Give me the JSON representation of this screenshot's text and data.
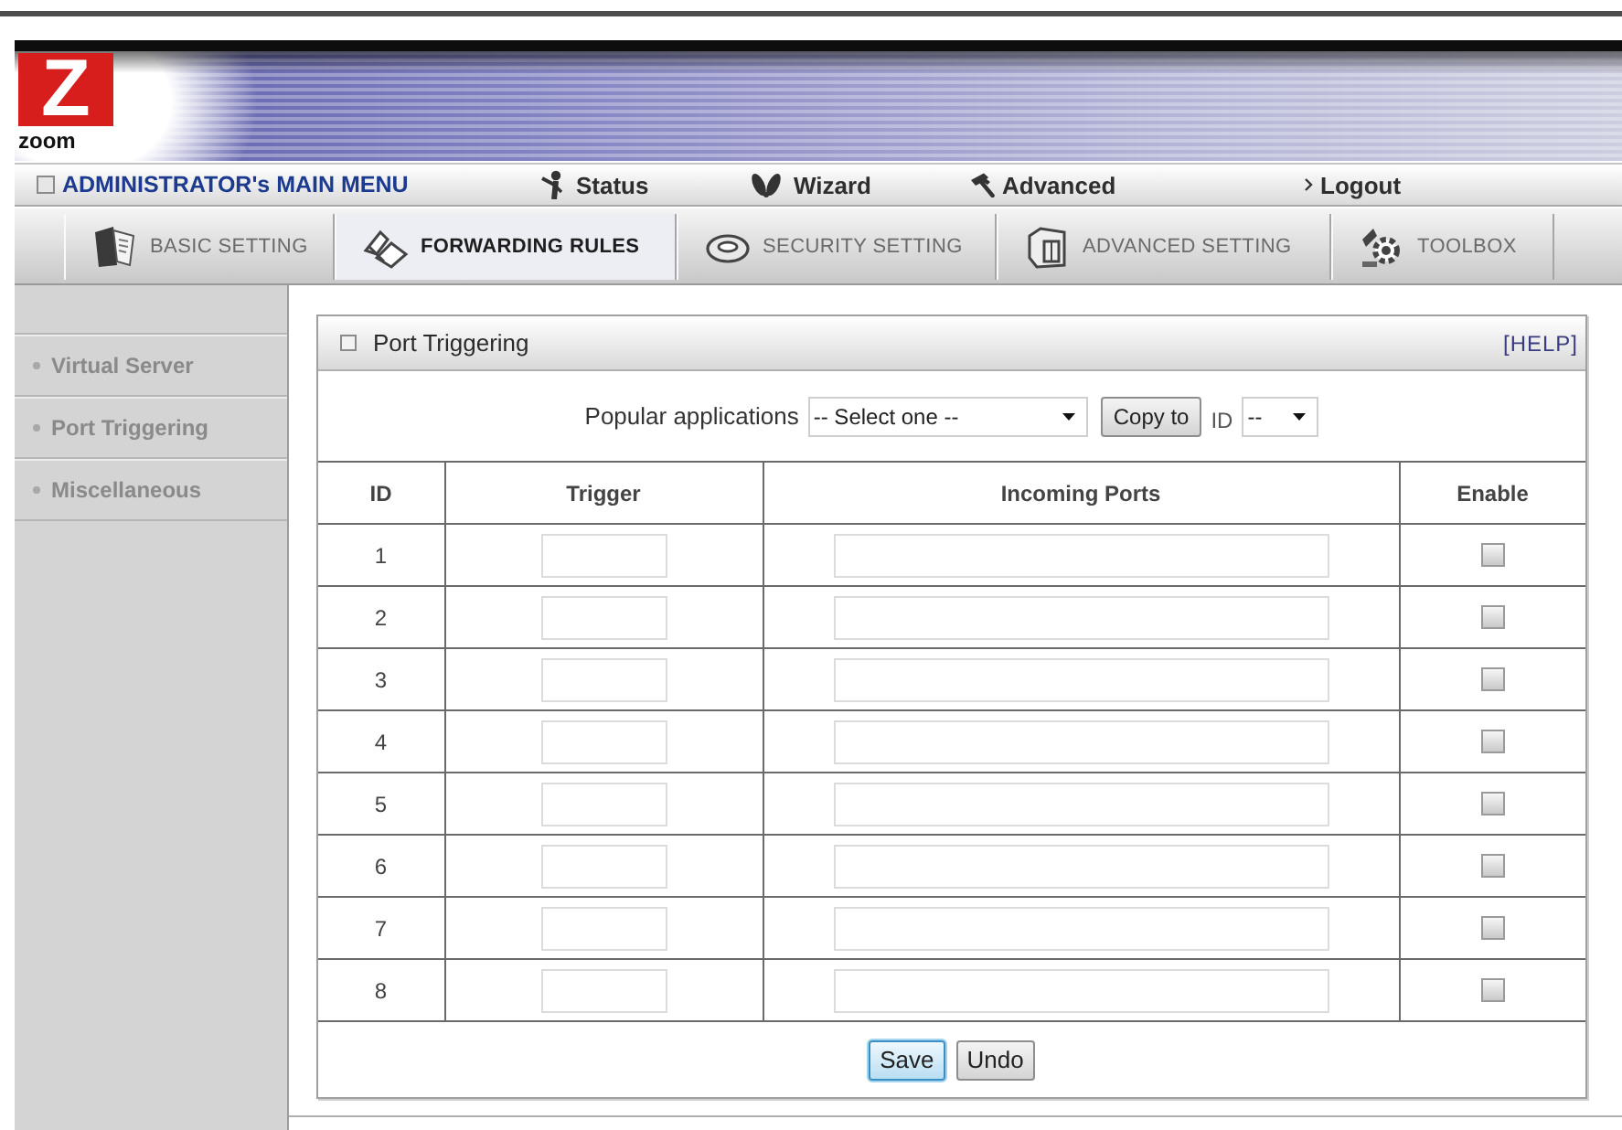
{
  "logo": {
    "mark": "Z",
    "text": "zoom"
  },
  "main_menu": {
    "title": "ADMINISTRATOR's MAIN MENU",
    "items": [
      {
        "label": "Status"
      },
      {
        "label": "Wizard"
      },
      {
        "label": "Advanced"
      },
      {
        "label": "Logout"
      }
    ]
  },
  "tabs": [
    {
      "label": "BASIC SETTING",
      "selected": false
    },
    {
      "label": "FORWARDING RULES",
      "selected": true
    },
    {
      "label": "SECURITY SETTING",
      "selected": false
    },
    {
      "label": "ADVANCED SETTING",
      "selected": false
    },
    {
      "label": "TOOLBOX",
      "selected": false
    }
  ],
  "sidebar": {
    "items": [
      {
        "label": "Virtual Server"
      },
      {
        "label": "Port Triggering"
      },
      {
        "label": "Miscellaneous"
      }
    ]
  },
  "panel": {
    "title": "Port Triggering",
    "help": "[HELP]",
    "popular": {
      "label": "Popular applications",
      "select": "-- Select one --",
      "copy_button": "Copy to",
      "id_label": "ID",
      "id_select": "--"
    },
    "table": {
      "columns": [
        "ID",
        "Trigger",
        "Incoming Ports",
        "Enable"
      ],
      "rows": [
        {
          "id": "1",
          "checked": false
        },
        {
          "id": "2",
          "checked": false
        },
        {
          "id": "3",
          "checked": false
        },
        {
          "id": "4",
          "checked": false
        },
        {
          "id": "5",
          "checked": false
        },
        {
          "id": "6",
          "checked": false
        },
        {
          "id": "7",
          "checked": false
        },
        {
          "id": "8",
          "checked": false
        }
      ]
    },
    "buttons": [
      {
        "label": "Save",
        "focused": true
      },
      {
        "label": "Undo",
        "focused": false
      }
    ]
  }
}
